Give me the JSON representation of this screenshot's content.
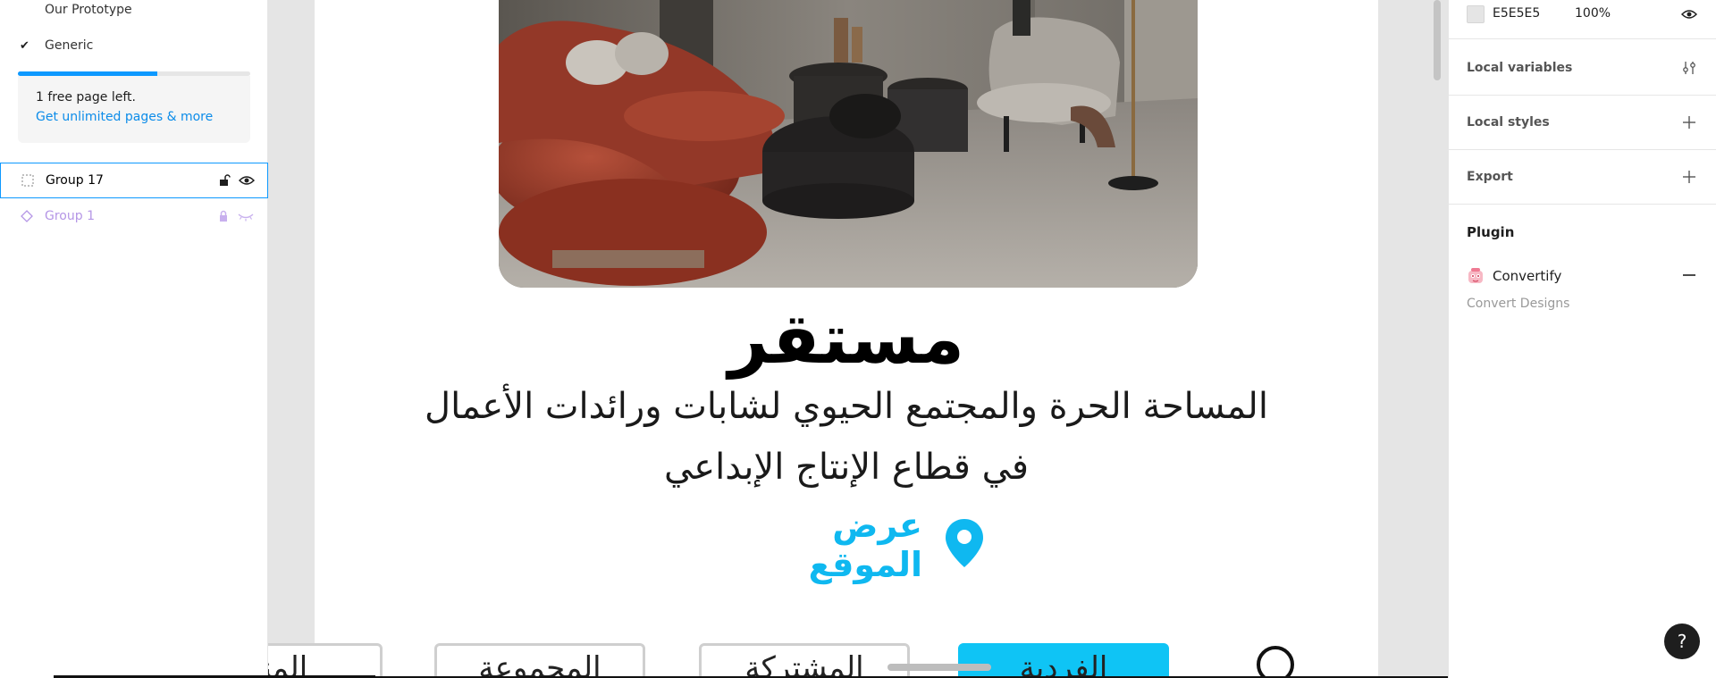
{
  "layers_panel": {
    "pages": [
      {
        "label": "Our Prototype",
        "checked": false
      },
      {
        "label": "Generic",
        "checked": true
      }
    ],
    "check_glyph": "✔",
    "free_pages_progress": 0.6,
    "upgrade_text": "1 free page left.",
    "upgrade_link": "Get unlimited pages & more",
    "layers": [
      {
        "name": "Group 17",
        "icon": "frame-dots-icon",
        "locked": false,
        "visible": true,
        "selected": true
      },
      {
        "name": "Group 1",
        "icon": "component-diamond-icon",
        "locked": true,
        "visible": false,
        "selected": false
      }
    ]
  },
  "canvas": {
    "title": "مستقر",
    "subtitle_line1": "المساحة الحرة والمجتمع الحيوي لشابات ورائدات الأعمال",
    "subtitle_line2": "في قطاع الإنتاج الإبداعي",
    "location_link": "عرض الموقع",
    "location_icon": "map-pin-icon",
    "tabs": [
      {
        "label": "الفردية",
        "active": true
      },
      {
        "label": "المشتركة",
        "active": false
      },
      {
        "label": "المجموعة",
        "active": false
      },
      {
        "label": "المنز",
        "active": false
      }
    ],
    "accent_color": "#0FC4F5"
  },
  "properties_panel": {
    "fill_hex": "E5E5E5",
    "fill_opacity": "100%",
    "sections": [
      {
        "label": "Local variables",
        "action_icon": "sliders-icon"
      },
      {
        "label": "Local styles",
        "action_icon": "plus-icon"
      },
      {
        "label": "Export",
        "action_icon": "plus-icon"
      }
    ],
    "plugin_heading": "Plugin",
    "plugin_name": "Convertify",
    "plugin_description": "Convert Designs"
  },
  "help_button": "?"
}
